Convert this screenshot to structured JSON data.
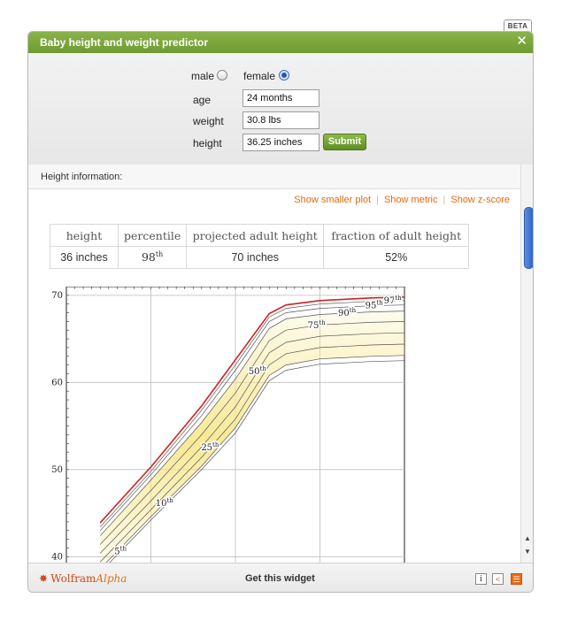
{
  "beta_label": "BETA",
  "widget": {
    "title": "Baby height and weight predictor",
    "close_glyph": "✕"
  },
  "form": {
    "gender_options": [
      {
        "label": "male",
        "selected": false
      },
      {
        "label": "female",
        "selected": true
      }
    ],
    "age": {
      "label": "age",
      "value": "24 months"
    },
    "weight": {
      "label": "weight",
      "value": "30.8 lbs"
    },
    "height": {
      "label": "height",
      "value": "36.25 inches"
    },
    "submit_label": "Submit"
  },
  "results": {
    "section_title": "Height information:",
    "links": [
      "Show smaller plot",
      "Show metric",
      "Show z-score"
    ],
    "table": {
      "headers": [
        "height",
        "percentile",
        "projected adult height",
        "fraction of adult height"
      ],
      "row": {
        "height": "36 inches",
        "percentile_number": "98",
        "percentile_suffix": "th",
        "projected": "70 inches",
        "fraction": "52%"
      }
    }
  },
  "chart_data": {
    "type": "line",
    "xlabel": "",
    "ylabel": "",
    "y_ticks": [
      40,
      50,
      60,
      70
    ],
    "ylim": [
      38,
      71
    ],
    "xlim": [
      0,
      20
    ],
    "x_gridlines": [
      5,
      10,
      15
    ],
    "grid": true,
    "band_color": "#f7e78a",
    "highlight_color": "#d62020",
    "series": [
      {
        "name": "5th",
        "label_number": "5",
        "label_at_x": 3.2,
        "points": [
          [
            2,
            38.2
          ],
          [
            5,
            44.2
          ],
          [
            8,
            50.0
          ],
          [
            10,
            54.2
          ],
          [
            12,
            60.2
          ],
          [
            13,
            61.4
          ],
          [
            15,
            62.1
          ],
          [
            18,
            62.4
          ],
          [
            20,
            62.5
          ]
        ]
      },
      {
        "name": "10th",
        "label_number": "10",
        "label_at_x": 5.8,
        "points": [
          [
            2,
            38.6
          ],
          [
            5,
            44.6
          ],
          [
            8,
            50.4
          ],
          [
            10,
            54.8
          ],
          [
            12,
            60.8
          ],
          [
            13,
            62.0
          ],
          [
            15,
            62.7
          ],
          [
            18,
            63.0
          ],
          [
            20,
            63.1
          ]
        ]
      },
      {
        "name": "25th",
        "label_number": "25",
        "label_at_x": 8.5,
        "points": [
          [
            2,
            39.4
          ],
          [
            5,
            45.4
          ],
          [
            8,
            51.4
          ],
          [
            10,
            55.8
          ],
          [
            12,
            62.0
          ],
          [
            13,
            63.3
          ],
          [
            15,
            64.0
          ],
          [
            18,
            64.3
          ],
          [
            20,
            64.4
          ]
        ]
      },
      {
        "name": "50th",
        "label_number": "50",
        "label_at_x": 11.3,
        "points": [
          [
            2,
            40.4
          ],
          [
            5,
            46.4
          ],
          [
            8,
            52.6
          ],
          [
            10,
            57.2
          ],
          [
            12,
            63.4
          ],
          [
            13,
            64.6
          ],
          [
            15,
            65.3
          ],
          [
            18,
            65.6
          ],
          [
            20,
            65.7
          ]
        ]
      },
      {
        "name": "75th",
        "label_number": "75",
        "label_at_x": 14.8,
        "points": [
          [
            2,
            41.4
          ],
          [
            5,
            47.6
          ],
          [
            8,
            54.0
          ],
          [
            10,
            58.8
          ],
          [
            12,
            64.8
          ],
          [
            13,
            66.0
          ],
          [
            15,
            66.6
          ],
          [
            18,
            66.9
          ],
          [
            20,
            67.0
          ]
        ]
      },
      {
        "name": "90th",
        "label_number": "90",
        "label_at_x": 16.6,
        "points": [
          [
            2,
            42.4
          ],
          [
            5,
            48.8
          ],
          [
            8,
            55.4
          ],
          [
            10,
            60.4
          ],
          [
            12,
            66.2
          ],
          [
            13,
            67.3
          ],
          [
            15,
            67.8
          ],
          [
            18,
            68.1
          ],
          [
            20,
            68.2
          ]
        ]
      },
      {
        "name": "95th",
        "label_number": "95",
        "label_at_x": 18.2,
        "points": [
          [
            2,
            43.0
          ],
          [
            5,
            49.4
          ],
          [
            8,
            56.2
          ],
          [
            10,
            61.4
          ],
          [
            12,
            67.0
          ],
          [
            13,
            68.0
          ],
          [
            15,
            68.5
          ],
          [
            18,
            68.8
          ],
          [
            20,
            68.9
          ]
        ]
      },
      {
        "name": "97th",
        "label_number": "97",
        "label_at_x": 19.3,
        "points": [
          [
            2,
            43.4
          ],
          [
            5,
            49.8
          ],
          [
            8,
            56.8
          ],
          [
            10,
            62.0
          ],
          [
            12,
            67.5
          ],
          [
            13,
            68.5
          ],
          [
            15,
            69.0
          ],
          [
            18,
            69.3
          ],
          [
            20,
            69.4
          ]
        ]
      },
      {
        "name": "98th",
        "label_number": "",
        "highlight": true,
        "points": [
          [
            2,
            43.9
          ],
          [
            5,
            50.3
          ],
          [
            8,
            57.3
          ],
          [
            10,
            62.6
          ],
          [
            12,
            67.9
          ],
          [
            13,
            68.9
          ],
          [
            15,
            69.4
          ],
          [
            18,
            69.7
          ],
          [
            20,
            69.8
          ]
        ]
      }
    ]
  },
  "footer": {
    "logo_wolfram": "Wolfram",
    "logo_alpha": "Alpha",
    "get_widget": "Get this widget",
    "info_glyph": "i",
    "share_glyph": "<",
    "embed_glyph": "☰"
  }
}
